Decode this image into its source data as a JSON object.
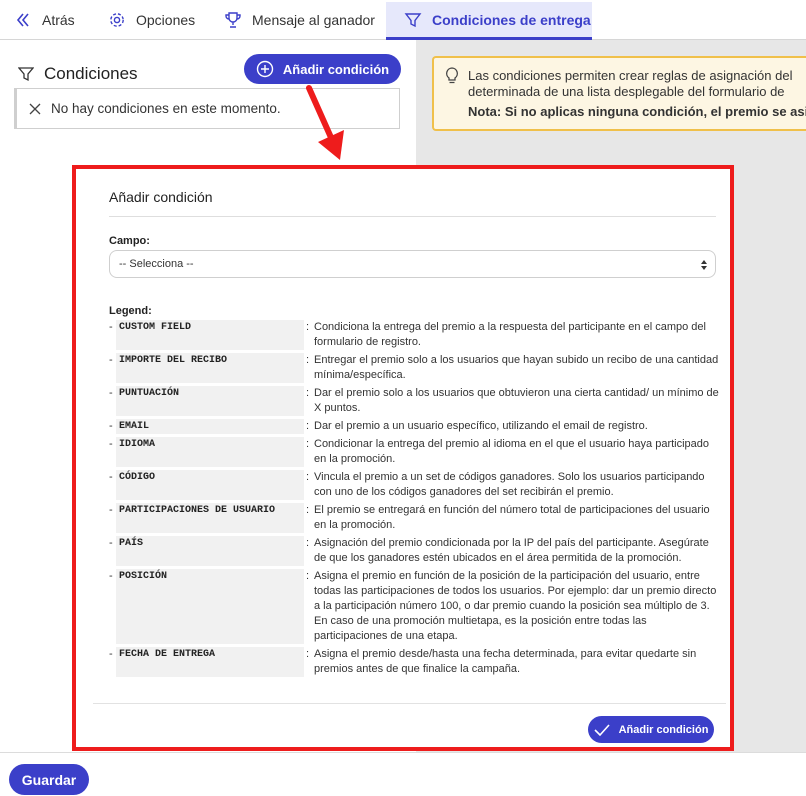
{
  "tabs": [
    {
      "label": "Atrás",
      "icon": "chevron-left-double-icon"
    },
    {
      "label": "Opciones",
      "icon": "gear-icon"
    },
    {
      "label": "Mensaje al ganador",
      "icon": "trophy-icon"
    },
    {
      "label": "Condiciones de entrega",
      "icon": "filter-icon",
      "active": true
    }
  ],
  "left": {
    "title": "Condiciones",
    "add_button": "Añadir condición",
    "empty_message": "No hay condiciones en este momento."
  },
  "info": {
    "line1": "Las condiciones permiten crear reglas de asignación del",
    "line2": "determinada de una lista desplegable del formulario de",
    "line3": "Nota: Si no aplicas ninguna condición, el premio se asi"
  },
  "modal": {
    "title": "Añadir condición",
    "campo_label": "Campo:",
    "select_value": "-- Selecciona --",
    "legend_title": "Legend:",
    "legend": [
      {
        "key": "CUSTOM FIELD",
        "desc": "Condiciona la entrega del premio a la respuesta del participante en el campo del formulario de registro."
      },
      {
        "key": "IMPORTE DEL RECIBO",
        "desc": "Entregar el premio solo a los usuarios que hayan subido un recibo de una cantidad mínima/específica."
      },
      {
        "key": "PUNTUACIÓN",
        "desc": "Dar el premio solo a los usuarios que obtuvieron una cierta cantidad/ un mínimo de X puntos."
      },
      {
        "key": "EMAIL",
        "desc": "Dar el premio a un usuario específico, utilizando el email de registro."
      },
      {
        "key": "IDIOMA",
        "desc": "Condicionar la entrega del premio al idioma en el que el usuario haya participado en la promoción."
      },
      {
        "key": "CÓDIGO",
        "desc": "Vincula el premio a un set de códigos ganadores. Solo los usuarios participando con uno de los códigos ganadores del set recibirán el premio."
      },
      {
        "key": "PARTICIPACIONES DE USUARIO",
        "desc": "El premio se entregará en función del número total de participaciones del usuario en la promoción."
      },
      {
        "key": "PAÍS",
        "desc": "Asignación del premio condicionada por la IP del país del participante. Asegúrate de que los ganadores estén ubicados en el área permitida de la promoción."
      },
      {
        "key": "POSICIÓN",
        "desc": "Asigna el premio en función de la posición de la participación del usuario, entre todas las participaciones de todos los usuarios. Por ejemplo: dar un premio directo a la participación número 100, o dar premio cuando la posición sea múltiplo de 3. En caso de una promoción multietapa, es la posición entre todas las participaciones de una etapa."
      },
      {
        "key": "FECHA DE ENTREGA",
        "desc": "Asigna el premio desde/hasta una fecha determinada, para evitar quedarte sin premios antes de que finalice la campaña."
      }
    ],
    "add_button": "Añadir condición"
  },
  "footer": {
    "save": "Guardar"
  },
  "colors": {
    "accent": "#3b3fc9",
    "annotation": "#ee1c1c",
    "info_border": "#f0c04a"
  }
}
